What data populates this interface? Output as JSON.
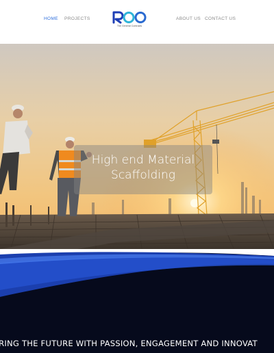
{
  "nav": {
    "left": [
      {
        "label": "HOME",
        "active": true
      },
      {
        "label": "PROJECTS",
        "active": false
      }
    ],
    "right": [
      {
        "label": "ABOUT US"
      },
      {
        "label": "CONTACT US"
      }
    ]
  },
  "logo": {
    "text": "ROO",
    "tagline": "The General Contracts",
    "colors": [
      "#1f3fb6",
      "#2fb4d8"
    ]
  },
  "hero": {
    "title_line1": "High end Material",
    "title_line2": "Scaffolding"
  },
  "footer_band": {
    "tagline": "ARING THE FUTURE WITH PASSION, ENGAGEMENT AND INNOVAT"
  },
  "colors": {
    "accent": "#2f6fdc",
    "wave_blue": "#1b3fae",
    "band_dark": "#060a1c"
  }
}
